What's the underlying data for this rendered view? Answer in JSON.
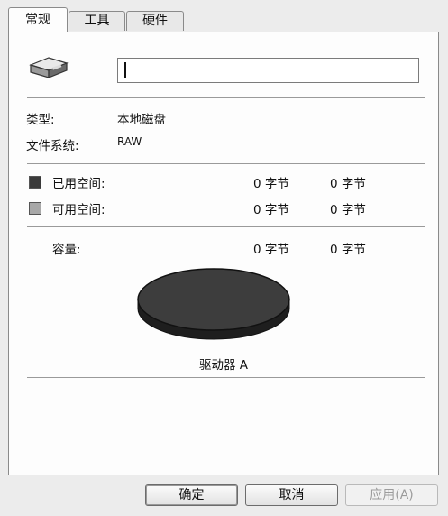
{
  "tabs": [
    {
      "label": "常规",
      "active": true
    },
    {
      "label": "工具",
      "active": false
    },
    {
      "label": "硬件",
      "active": false
    }
  ],
  "general": {
    "drive_icon": "removable-disk-icon",
    "name_value": "",
    "type_label": "类型:",
    "type_value": "本地磁盘",
    "fs_label": "文件系统:",
    "fs_value": "RAW",
    "used": {
      "label": "已用空间:",
      "bytes": "0 字节",
      "size": "0 字节",
      "color": "#3a3a3a"
    },
    "free": {
      "label": "可用空间:",
      "bytes": "0 字节",
      "size": "0 字节",
      "color": "#a8a8a8"
    },
    "capacity": {
      "label": "容量:",
      "bytes": "0 字节",
      "size": "0 字节"
    },
    "pie_color": "#3d3d3d",
    "drive_label": "驱动器 A"
  },
  "buttons": {
    "ok": "确定",
    "cancel": "取消",
    "apply": "应用(A)"
  }
}
